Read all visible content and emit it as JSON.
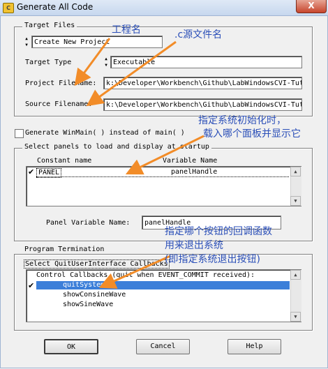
{
  "window": {
    "title": "Generate All Code",
    "close_glyph": "X",
    "icon": "app-icon"
  },
  "target_files": {
    "group_label": "Target Files",
    "combo_value": "Create New Project",
    "target_type_label": "Target Type",
    "target_type_value": "Executable",
    "project_filename_label": "Project Filename:",
    "project_filename_value": "k:\\Developer\\Workbench\\Github\\LabWindowsCVI-Tut",
    "source_filename_label": "Source Filename:",
    "source_filename_value": "k:\\Developer\\Workbench\\Github\\LabWindowsCVI-Tut"
  },
  "generate_winmain": {
    "label": "Generate WinMain( ) instead of main( )",
    "checked": false
  },
  "panels": {
    "group_label": "Select panels to load and display at startup",
    "col_constant": "Constant name",
    "col_variable": "Variable Name",
    "rows": [
      {
        "check": "✔",
        "constant": "PANEL",
        "variable": "panelHandle"
      }
    ],
    "panel_var_label": "Panel Variable Name:",
    "panel_var_value": "panelHandle"
  },
  "termination": {
    "group_label": "Program Termination",
    "callbacks_label": "Select QuitUserInterface Callbacks",
    "list_header": "Control Callbacks  (quit when EVENT_COMMIT received):",
    "items": [
      {
        "check": "✔",
        "label": "quitSystem",
        "selected": true
      },
      {
        "check": "",
        "label": "showConsineWave",
        "selected": false
      },
      {
        "check": "",
        "label": "showSineWave",
        "selected": false
      }
    ]
  },
  "buttons": {
    "ok": "OK",
    "cancel": "Cancel",
    "help": "Help"
  },
  "annotations": {
    "project_name": "工程名",
    "c_source": ".c源文件名",
    "init_line1": "指定系统初始化时，",
    "init_line2": "载入哪个面板并显示它",
    "quit_line1": "指定哪个按钮的回调函数",
    "quit_line2": "用来退出系统",
    "quit_line3": "(即指定系统退出按钮)"
  },
  "colors": {
    "annotation": "#2b4fb8",
    "arrow": "#f28c28",
    "selection": "#3c7fd9"
  }
}
